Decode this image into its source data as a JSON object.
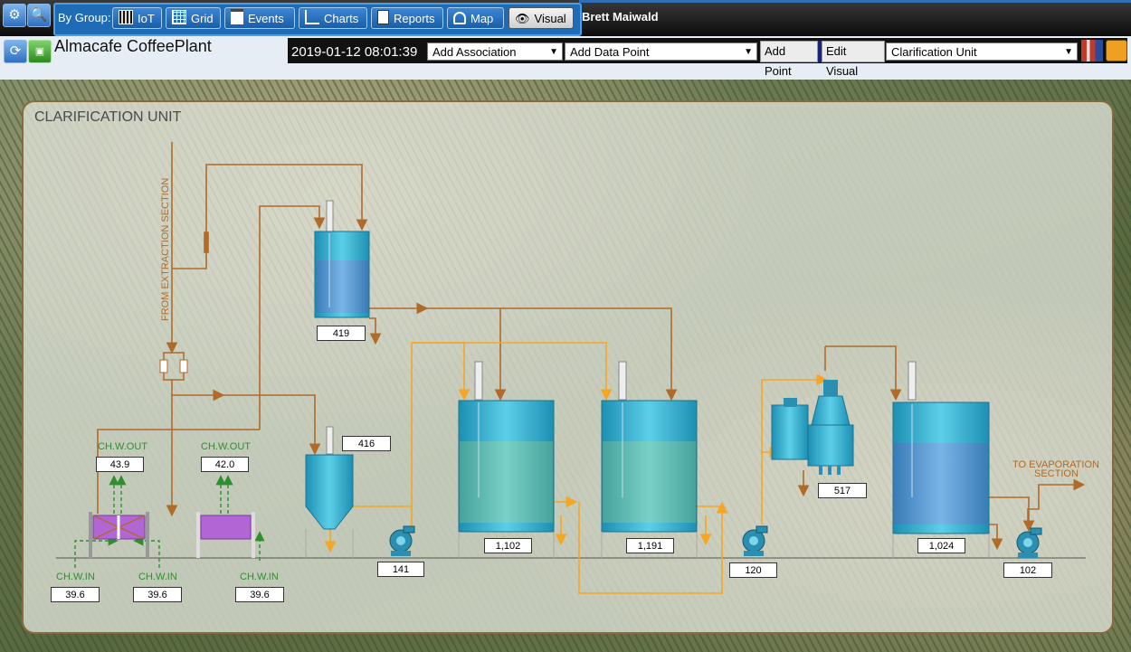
{
  "topbar": {
    "group_label": "By Group:",
    "user": "Brett Maiwald",
    "groups": [
      {
        "label": "IoT"
      },
      {
        "label": "Grid"
      },
      {
        "label": "Events"
      },
      {
        "label": "Charts"
      },
      {
        "label": "Reports"
      },
      {
        "label": "Map"
      },
      {
        "label": "Visual"
      }
    ]
  },
  "app": {
    "title": "Almacafe CoffeePlant"
  },
  "toolbar": {
    "datetime": "2019-01-12 08:01:39",
    "add_association": "Add Association",
    "add_data_point": "Add Data Point",
    "add_point": "Add Point",
    "edit_visual": "Edit Visual",
    "visual_select": "Clarification Unit"
  },
  "panel": {
    "title": "CLARIFICATION UNIT"
  },
  "labels": {
    "from_extraction": "FROM EXTRACTION SECTION",
    "to_evaporation_1": "TO EVAPORATION",
    "to_evaporation_2": "SECTION",
    "chw_out_1": "CH.W.OUT",
    "chw_out_2": "CH.W.OUT",
    "chw_in_1": "CH.W.IN",
    "chw_in_2": "CH.W.IN",
    "chw_in_3": "CH.W.IN"
  },
  "values": {
    "chw_out_1": "43.9",
    "chw_out_2": "42.0",
    "chw_in_1": "39.6",
    "chw_in_2": "39.6",
    "chw_in_3": "39.6",
    "tank_top": "419",
    "cone_tank": "416",
    "pump_1": "141",
    "tank_1": "1,102",
    "tank_2": "1,191",
    "pump_2": "120",
    "centrifuge": "517",
    "tank_3": "1,024",
    "pump_3": "102"
  },
  "colors": {
    "pipe_brown": "#b06a2a",
    "pipe_orange": "#f5a623",
    "vessel": "#3cb6d6",
    "chw_green": "#2f8f2f",
    "heat_exchanger": "#b266d6"
  }
}
